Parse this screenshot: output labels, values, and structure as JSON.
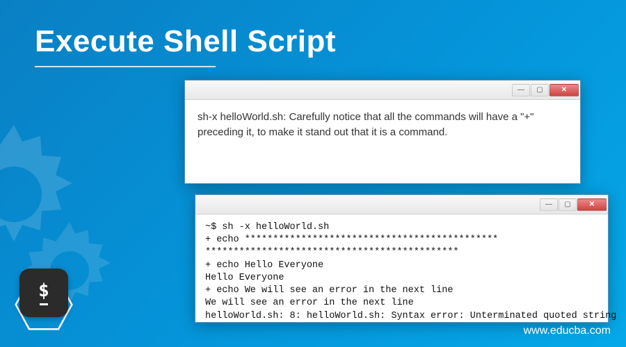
{
  "page_title": "Execute Shell Script",
  "window1": {
    "text": "sh-x helloWorld.sh: Carefully notice that all the commands will have a \"+\" preceding it, to make it stand out that it is a command."
  },
  "window2": {
    "lines": {
      "l1": "~$ sh -x helloWorld.sh",
      "l2": "+ echo *********************************************",
      "l3": "*********************************************",
      "l4": "+ echo Hello Everyone",
      "l5": "Hello Everyone",
      "l6": "+ echo We will see an error in the next line",
      "l7": "We will see an error in the next line",
      "l8": "helloWorld.sh: 8: helloWorld.sh: Syntax error: Unterminated quoted string"
    }
  },
  "shell_prompt_symbol": "$",
  "footer_url": "www.educba.com"
}
